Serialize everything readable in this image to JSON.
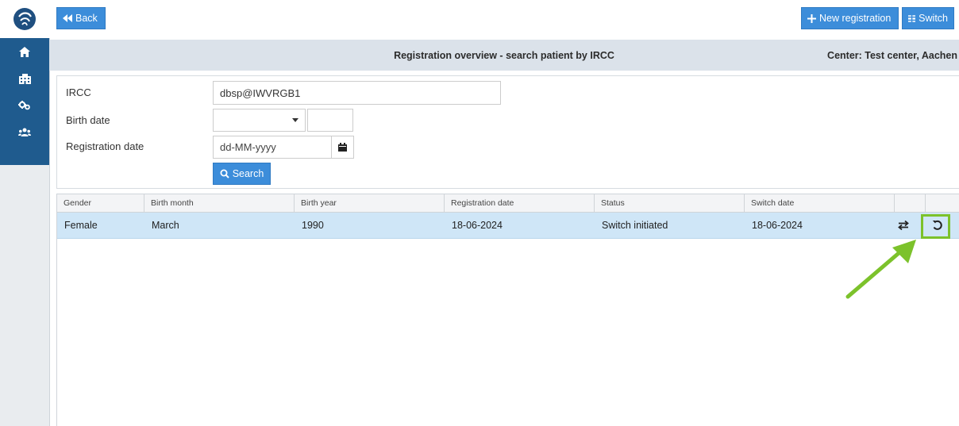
{
  "toolbar": {
    "back_label": "Back",
    "new_registration_label": "New registration",
    "switch_label": "Switch"
  },
  "header": {
    "title": "Registration overview - search patient by IRCC",
    "center": "Center: Test center, Aachen"
  },
  "sidebar": {
    "items": [
      {
        "icon": "home-icon"
      },
      {
        "icon": "building-icon"
      },
      {
        "icon": "cogs-icon"
      },
      {
        "icon": "users-icon"
      }
    ]
  },
  "form": {
    "ircc_label": "IRCC",
    "ircc_value": "dbsp@IWVRGB1",
    "birth_date_label": "Birth date",
    "birth_month_value": "",
    "birth_year_value": "",
    "registration_date_label": "Registration date",
    "registration_date_placeholder": "dd-MM-yyyy",
    "search_label": "Search"
  },
  "table": {
    "columns": [
      "Gender",
      "Birth month",
      "Birth year",
      "Registration date",
      "Status",
      "Switch date"
    ],
    "rows": [
      {
        "gender": "Female",
        "birth_month": "March",
        "birth_year": "1990",
        "registration_date": "18-06-2024",
        "status": "Switch initiated",
        "switch_date": "18-06-2024"
      }
    ]
  },
  "colors": {
    "primary": "#3c8dda",
    "sidebar_nav": "#1f5b8e",
    "selected_row": "#cfe6f7",
    "highlight": "#7cc22b"
  }
}
